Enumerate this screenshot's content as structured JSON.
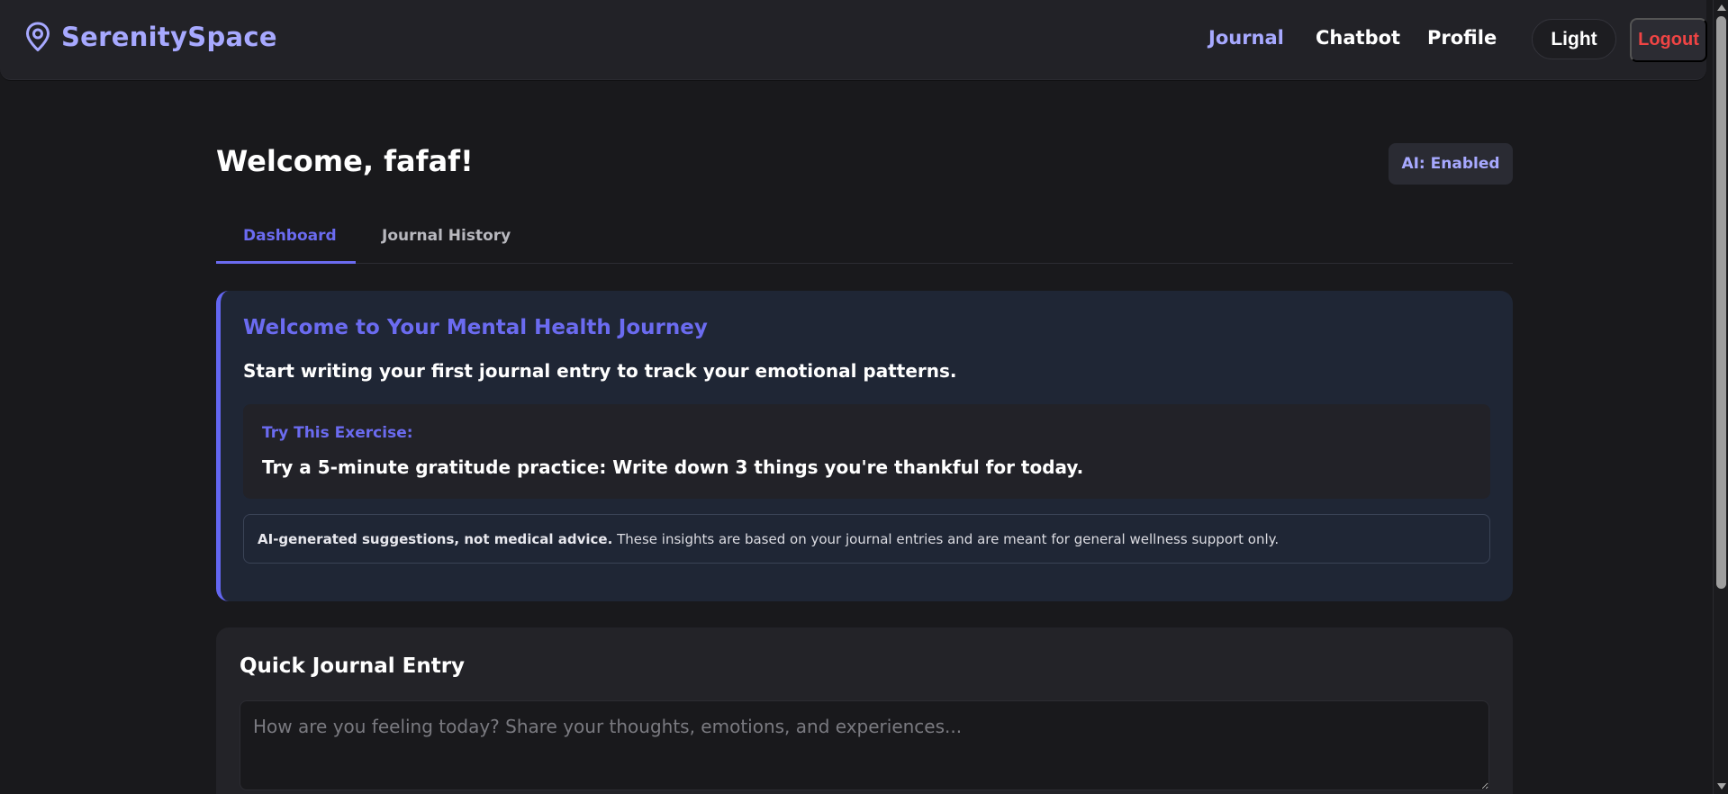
{
  "brand": {
    "name": "SerenitySpace",
    "icon": "location-pin-icon",
    "color": "#a7a9ff"
  },
  "nav": {
    "links": [
      {
        "label": "Journal",
        "active": true
      },
      {
        "label": "Chatbot",
        "active": false
      },
      {
        "label": "Profile",
        "active": false
      }
    ],
    "theme_toggle_label": "Light",
    "logout_label": "Logout"
  },
  "main": {
    "welcome_title": "Welcome, fafaf!",
    "ai_badge": "AI: Enabled",
    "tabs": [
      {
        "label": "Dashboard",
        "active": true
      },
      {
        "label": "Journal History",
        "active": false
      }
    ]
  },
  "journey_card": {
    "title": "Welcome to Your Mental Health Journey",
    "subtitle": "Start writing your first journal entry to track your emotional patterns.",
    "exercise_label": "Try This Exercise:",
    "exercise_text": "Try a 5-minute gratitude practice: Write down 3 things you're thankful for today.",
    "disclaimer_bold": "AI-generated suggestions, not medical advice.",
    "disclaimer_text": " These insights are based on your journal entries and are meant for general wellness support only."
  },
  "quick_entry": {
    "title": "Quick Journal Entry",
    "value": "",
    "placeholder": "How are you feeling today? Share your thoughts, emotions, and experiences..."
  },
  "colors": {
    "background": "#19191c",
    "accent": "#6366f1",
    "logout": "#f04444",
    "card": "#1f2635"
  }
}
